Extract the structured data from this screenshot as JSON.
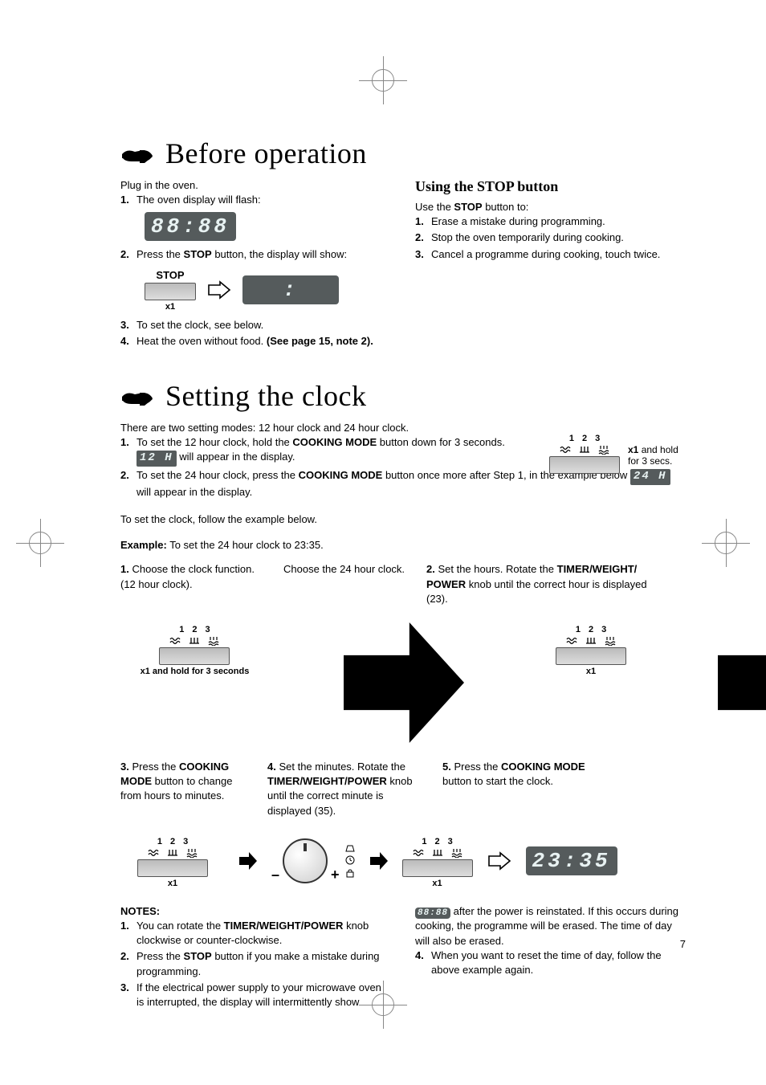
{
  "page_number": "7",
  "section1": {
    "title": "Before operation",
    "intro": "Plug in the oven.",
    "li1": "The oven display will flash:",
    "lcd1": "88:88",
    "li2_pre": "Press the ",
    "li2_bold": "STOP",
    "li2_post": " button, the display will show:",
    "stop_label": "STOP",
    "stop_sub": "x1",
    "lcd_blank": " : ",
    "li3": "To set the clock, see below.",
    "li4_pre": "Heat the oven without food. ",
    "li4_bold": "(See page 15, note 2).",
    "right": {
      "h": "Using the STOP button",
      "lead_pre": "Use the ",
      "lead_bold": "STOP",
      "lead_post": " button to:",
      "li1": "Erase a mistake during programming.",
      "li2": "Stop the oven temporarily during cooking.",
      "li3": "Cancel a programme during cooking, touch twice."
    }
  },
  "section2": {
    "title": "Setting the clock",
    "intro": "There are two setting modes: 12 hour clock and 24 hour clock.",
    "li1_pre": "To set the 12 hour clock, hold the ",
    "li1_bold": "COOKING MODE",
    "li1_post": " button down for 3 seconds.",
    "li1b_lcd": "12 H",
    "li1b_post": " will appear in the display.",
    "li2_pre": "To set the 24 hour clock, press the ",
    "li2_bold": "COOKING MODE",
    "li2_post": " button once more after Step 1, in the example below ",
    "li2_lcd": "24 H",
    "li2_end": " will appear in the display.",
    "side_sub_pre": "x1",
    "side_sub_post": " and hold for 3 secs.",
    "follow": "To set the clock, follow the example below.",
    "example_bold": "Example:",
    "example_post": " To set the 24 hour clock to 23:35.",
    "step1a": "Choose the clock function. (12 hour clock).",
    "step1b": "Choose the 24 hour clock.",
    "step2_pre": "Set the hours. Rotate the ",
    "step2_bold": "TIMER/WEIGHT/ POWER",
    "step2_post": " knob until the correct hour is displayed (23).",
    "step3_pre": "Press the ",
    "step3_bold": "COOKING MODE",
    "step3_post": " button to change from hours to minutes.",
    "step4_pre": "Set the minutes.  Rotate the ",
    "step4_bold": "TIMER/WEIGHT/POWER",
    "step4_post": " knob until the correct minute is displayed (35).",
    "step5_pre": "Press the ",
    "step5_bold": "COOKING MODE",
    "step5_post": " button to start the clock.",
    "x1": "x1",
    "x1_hold3": "x1 and hold for 3 seconds",
    "final_lcd": "23:35",
    "mode_1": "1",
    "mode_2": "2",
    "mode_3": "3",
    "minus": "–",
    "plus": "+"
  },
  "notes": {
    "h": "NOTES:",
    "n1_pre": "You can rotate the ",
    "n1_bold": "TIMER/WEIGHT/POWER",
    "n1_post": " knob clockwise or counter-clockwise.",
    "n2_pre": "Press the ",
    "n2_bold": "STOP",
    "n2_post": " button if you make a mistake during programming.",
    "n3": "If the electrical power supply to your microwave oven is interrupted, the display will intermittently show",
    "n3_lcd": "88:88",
    "n3b": " after the power is reinstated. If this occurs during cooking, the programme will be erased. The time of day will also be erased.",
    "n4": "When you want to reset the time of day, follow the above example again."
  }
}
